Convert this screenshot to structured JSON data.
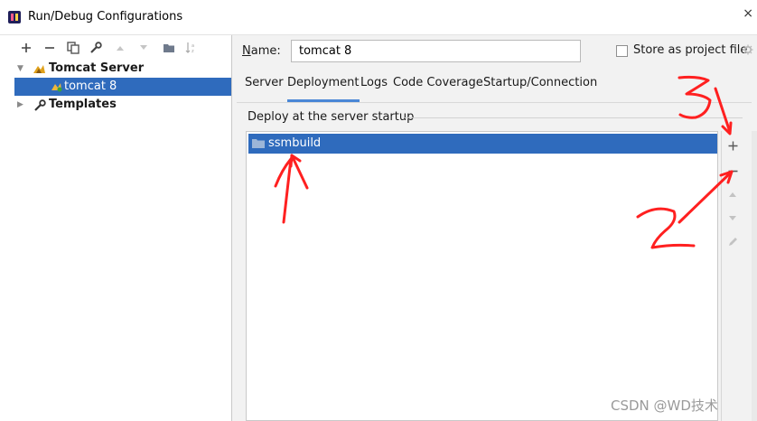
{
  "window": {
    "title": "Run/Debug Configurations",
    "close_glyph": "×"
  },
  "toolbar_icons": [
    "add-icon",
    "remove-icon",
    "copy-icon",
    "wrench-icon",
    "move-up-icon",
    "move-down-icon",
    "folder-icon",
    "sort-icon"
  ],
  "tree": {
    "items": [
      {
        "label": "Tomcat Server",
        "expanded": true,
        "icon": "tomcat-icon"
      },
      {
        "label": "tomcat 8",
        "selected": true,
        "icon": "tomcat-config-icon"
      },
      {
        "label": "Templates",
        "expanded": false,
        "icon": "wrench-icon"
      }
    ]
  },
  "form": {
    "name_label_mnemonic": "N",
    "name_label_rest": "ame:",
    "name_value": "tomcat 8",
    "store_label": "Store as project file",
    "store_checked": false
  },
  "tabs": [
    {
      "label": "Server",
      "active": false
    },
    {
      "label": "Deployment",
      "active": true
    },
    {
      "label": "Logs",
      "active": false
    },
    {
      "label": "Code Coverage",
      "active": false
    },
    {
      "label": "Startup/Connection",
      "active": false
    }
  ],
  "deployment": {
    "legend": "Deploy at the server startup",
    "items": [
      {
        "label": "ssmbuild",
        "selected": true
      }
    ]
  },
  "side_tools": [
    "add-icon",
    "remove-icon",
    "move-up-icon",
    "move-down-icon",
    "edit-icon"
  ],
  "annotations": {
    "color": "#ff2020",
    "labels": [
      "3",
      "1",
      "2"
    ]
  },
  "watermark": "CSDN @WD技术",
  "colors": {
    "selection": "#2f6bbd",
    "tab_underline": "#4a87d6"
  }
}
